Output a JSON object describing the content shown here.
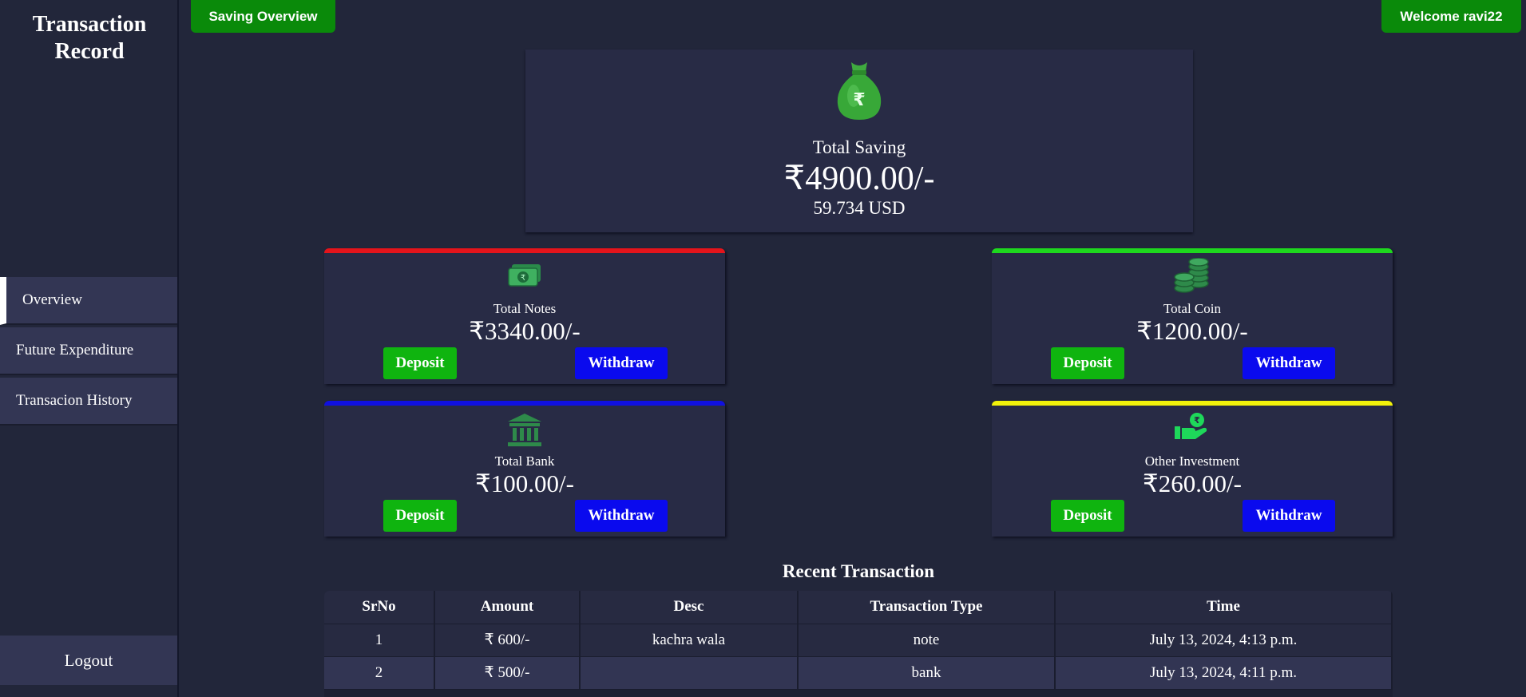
{
  "sidebar": {
    "brand": "Transaction Record",
    "items": [
      {
        "label": "Overview"
      },
      {
        "label": "Future Expenditure"
      },
      {
        "label": "Transacion History"
      }
    ],
    "logout": "Logout"
  },
  "header": {
    "tab": "Saving Overview",
    "welcome": "Welcome ravi22"
  },
  "saving": {
    "title": "Total Saving",
    "amount": "₹4900.00/-",
    "usd": "59.734 USD"
  },
  "cards": [
    {
      "label": "Total Notes",
      "amount": "₹3340.00/-",
      "accent": "#e4141b",
      "icon": "banknote-icon",
      "deposit": "Deposit",
      "withdraw": "Withdraw"
    },
    {
      "label": "Total Coin",
      "amount": "₹1200.00/-",
      "accent": "#1ed81e",
      "icon": "coins-icon",
      "deposit": "Deposit",
      "withdraw": "Withdraw"
    },
    {
      "label": "Total Bank",
      "amount": "₹100.00/-",
      "accent": "#1010e0",
      "icon": "bank-icon",
      "deposit": "Deposit",
      "withdraw": "Withdraw"
    },
    {
      "label": "Other Investment",
      "amount": "₹260.00/-",
      "accent": "#f2f20a",
      "icon": "hand-coin-icon",
      "deposit": "Deposit",
      "withdraw": "Withdraw"
    }
  ],
  "recent": {
    "title": "Recent Transaction",
    "columns": [
      "SrNo",
      "Amount",
      "Desc",
      "Transaction Type",
      "Time"
    ],
    "rows": [
      [
        "1",
        "₹ 600/-",
        "kachra wala",
        "note",
        "July 13, 2024, 4:13 p.m."
      ],
      [
        "2",
        "₹ 500/-",
        "",
        "bank",
        "July 13, 2024, 4:11 p.m."
      ]
    ]
  },
  "colors": {
    "background": "#22263a",
    "card": "#282b45",
    "green": "#0fb40f",
    "blue": "#0a0aee"
  }
}
